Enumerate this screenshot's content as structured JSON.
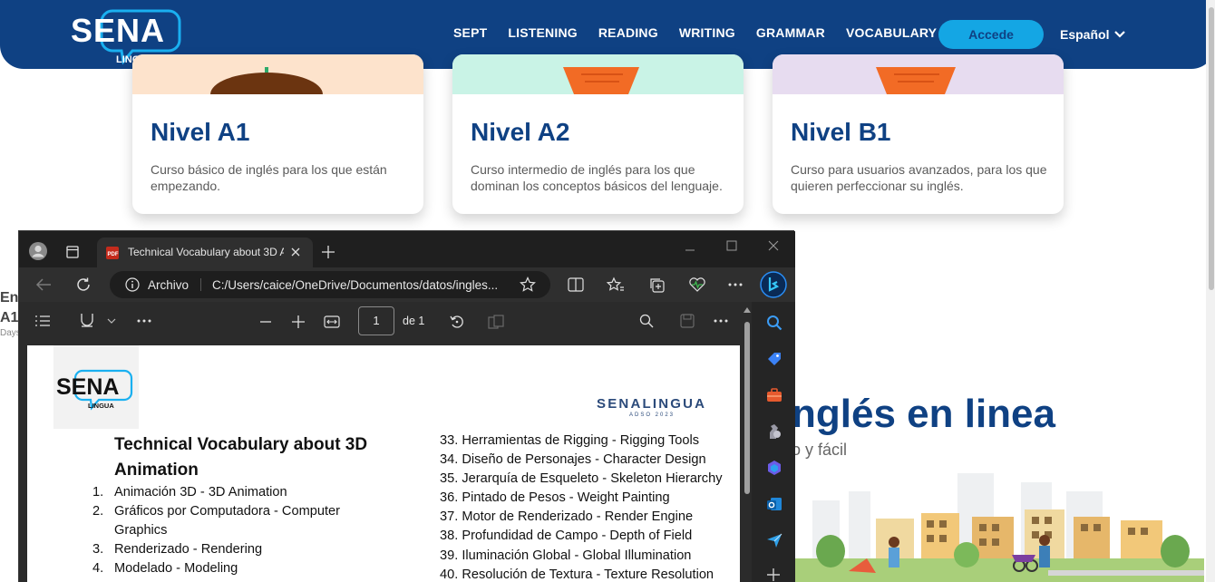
{
  "site": {
    "logo_text": "SENA",
    "logo_sub": "LINGUA",
    "nav": [
      "SEPT",
      "LISTENING",
      "READING",
      "WRITING",
      "GRAMMAR",
      "VOCABULARY"
    ],
    "login_button": "Accede",
    "language": "Español",
    "cards": [
      {
        "title": "Nivel A1",
        "description": "Curso básico de inglés para los que están empezando.",
        "color": "#fde3cc"
      },
      {
        "title": "Nivel A2",
        "description": "Curso intermedio de inglés para los que dominan los conceptos básicos del lenguaje.",
        "color": "#c9f3e6"
      },
      {
        "title": "Nivel B1",
        "description": "Curso para usuarios avanzados, para los que quieren perfeccionar su inglés.",
        "color": "#e7dcf0"
      }
    ],
    "hero_title": "nglés en linea",
    "hero_subtitle": "o y fácil",
    "left_fragment": {
      "line1": "Eng",
      "line2": "A1",
      "line3": "Days"
    },
    "colors": {
      "primary": "#0f4183",
      "accent": "#14a6e4"
    }
  },
  "browser": {
    "tab_title": "Technical Vocabulary about 3D A",
    "address_prefix": "Archivo",
    "address_url": "C:/Users/caice/OneDrive/Documentos/datos/ingles...",
    "page_number": "1",
    "page_of": "de 1"
  },
  "pdf": {
    "logo_text": "SENA",
    "logo_sub": "LINGUA",
    "brand": "SENALINGUA",
    "brand_sub": "ADSO 2023",
    "title": "Technical Vocabulary about 3D Animation",
    "items_left": [
      {
        "num": "1.",
        "text": "Animación 3D - 3D Animation"
      },
      {
        "num": "2.",
        "text": "Gráficos por Computadora - Computer Graphics"
      },
      {
        "num": "3.",
        "text": "Renderizado - Rendering"
      },
      {
        "num": "4.",
        "text": "Modelado - Modeling"
      }
    ],
    "items_right": [
      "33. Herramientas de Rigging - Rigging Tools",
      "34. Diseño de Personajes - Character Design",
      "35. Jerarquía de Esqueleto - Skeleton Hierarchy",
      "36. Pintado de Pesos - Weight Painting",
      "37. Motor de Renderizado - Render Engine",
      "38. Profundidad de Campo - Depth of Field",
      "39. Iluminación Global - Global Illumination",
      "40. Resolución de Textura - Texture Resolution"
    ]
  }
}
